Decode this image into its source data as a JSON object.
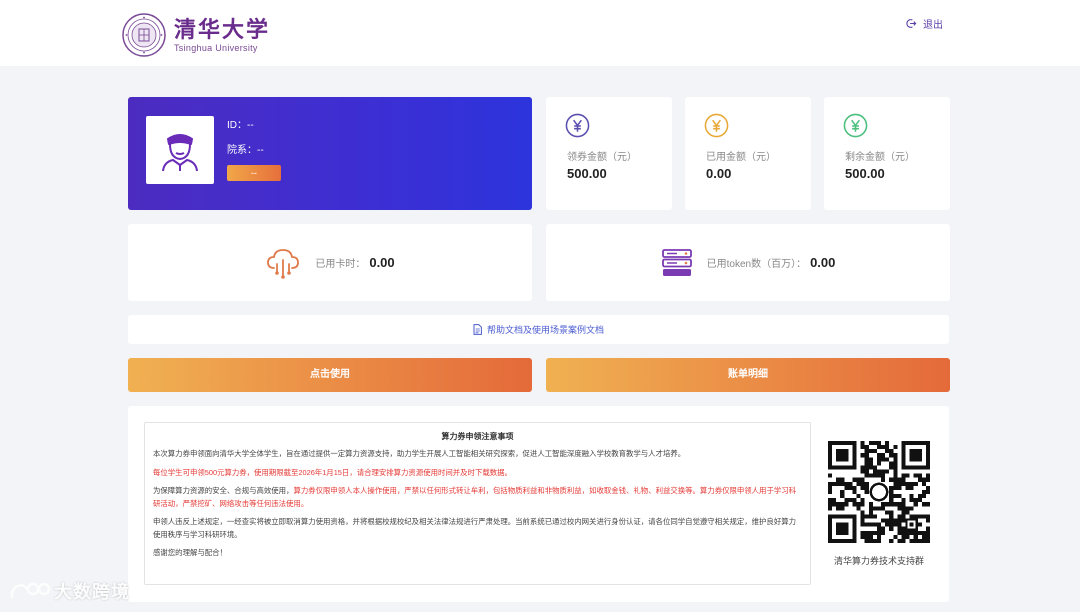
{
  "header": {
    "logo_cn": "清华大学",
    "logo_en": "Tsinghua University",
    "logout_label": "退出"
  },
  "profile": {
    "id_label": "ID：",
    "id_value": "--",
    "dept_label": "院系：",
    "dept_value": "--",
    "badge": "--"
  },
  "stats": [
    {
      "label": "领券金额（元）",
      "value": "500.00",
      "icon": "yuan-icon",
      "color": "#5b4fb0"
    },
    {
      "label": "已用金额（元）",
      "value": "0.00",
      "icon": "yuan-icon",
      "color": "#e8a93a"
    },
    {
      "label": "剩余金额（元）",
      "value": "500.00",
      "icon": "yuan-icon",
      "color": "#4bbf7e"
    }
  ],
  "usage": {
    "card_hours_label": "已用卡时：",
    "card_hours_value": "0.00",
    "tokens_label": "已用token数（百万）：",
    "tokens_value": "0.00"
  },
  "help_link": "帮助文档及使用场景案例文档",
  "buttons": {
    "use": "点击使用",
    "bill": "账单明细"
  },
  "notice": {
    "title": "算力券申领注意事项",
    "p1": "本次算力券申领面向清华大学全体学生，旨在通过提供一定算力资源支持，助力学生开展人工智能相关研究探索，促进人工智能深度融入学校教育教学与人才培养。",
    "p2": "每位学生可申领500元算力券，使用期限截至2026年1月15日，请合理安排算力资源使用时间并及时下载数据。",
    "p3a": "为保障算力资源的安全、合规与高效使用，",
    "p3b": "算力券仅限申领人本人操作使用，严禁以任何形式转让牟利，包括物质利益和非物质利益，如收取金钱、礼物、利益交换等。算力券仅限申领人用于学习科研活动，严禁挖矿、网络攻击等任何违法使用。",
    "p4": "申领人违反上述规定，一经查实将被立即取消算力使用资格，并将根据校规校纪及相关法律法规进行严肃处理。当前系统已通过校内网关进行身份认证，请各位同学自觉遵守相关规定，维护良好算力使用秩序与学习科研环境。",
    "p5": "感谢您的理解与配合！"
  },
  "qr_caption": "清华算力券技术支持群",
  "watermark": "大数跨境",
  "colors": {
    "primary": "#4c2cc0",
    "accent_orange": "#e46a3a",
    "link": "#4a5bd0",
    "warning_red": "#e53935"
  }
}
